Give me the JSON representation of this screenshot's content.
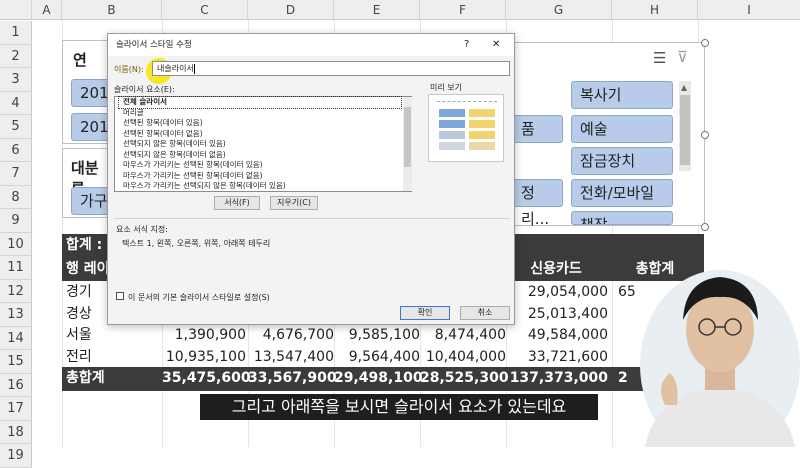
{
  "sheet": {
    "columns": [
      "A",
      "B",
      "C",
      "D",
      "E",
      "F",
      "G",
      "H",
      "I"
    ],
    "rows": [
      "1",
      "2",
      "3",
      "4",
      "5",
      "6",
      "7",
      "8",
      "9",
      "10",
      "11",
      "12",
      "13",
      "14",
      "15",
      "16",
      "17",
      "18",
      "19"
    ]
  },
  "slicer_year": {
    "title": "연",
    "items": [
      "201",
      "201"
    ]
  },
  "slicer_category": {
    "title": "대분류",
    "items": [
      "가구",
      "정리...",
      "전화/모바일",
      "복사기",
      "예술",
      "잠금장치",
      "책장"
    ],
    "partial_item": "품"
  },
  "table": {
    "header_label": "합계 :",
    "row_label_header": "행 레이",
    "col_headers": [
      "신용카드",
      "총합계"
    ],
    "rows": [
      {
        "label": "경기",
        "values": [
          "",
          "",
          "",
          "",
          "29,054,000",
          "65"
        ]
      },
      {
        "label": "경상",
        "values": [
          "",
          "",
          "",
          "",
          "25,013,400",
          ""
        ]
      },
      {
        "label": "서울",
        "values": [
          "1,390,900",
          "4,676,700",
          "9,585,100",
          "8,474,400",
          "49,584,000",
          ""
        ]
      },
      {
        "label": "전리",
        "values": [
          "10,935,100",
          "13,547,400",
          "9,564,400",
          "10,404,000",
          "33,721,600",
          ""
        ]
      }
    ],
    "total": {
      "label": "총합계",
      "values": [
        "35,475,600",
        "33,567,900",
        "29,498,100",
        "28,525,300",
        "137,373,000",
        "2"
      ]
    }
  },
  "dialog": {
    "title": "슬라이서 스타일 수정",
    "help": "?",
    "close": "✕",
    "name_label": "이름(N):",
    "name_value": "내슬라이서",
    "elements_label": "슬라이서 요소(E):",
    "elements": [
      "전체 슬라이서",
      "머리글",
      "선택된 항목(데이터 있음)",
      "선택된 항목(데이터 없음)",
      "선택되지 않은 항목(데이터 있음)",
      "선택되지 않은 항목(데이터 없음)",
      "마우스가 가리키는 선택된 항목(데이터 있음)",
      "마우스가 가리키는 선택된 항목(데이터 없음)",
      "마우스가 가리키는 선택되지 않은 항목(데이터 있음)"
    ],
    "preview_label": "미리 보기",
    "format_button": "서식(F)",
    "clear_button": "지우기(C)",
    "element_format_label": "요소 서식 지정:",
    "element_format_value": "텍스트 1, 왼쪽, 오른쪽, 위쪽, 아래쪽 테두리",
    "default_checkbox_label": "이 문서의 기본 슬라이서 스타일로 설정(S)",
    "ok_button": "확인",
    "cancel_button": "취소"
  },
  "subtitle": "그리고 아래쪽을 보시면 슬라이서 요소가 있는데요",
  "colors": {
    "slicer_button": "#b7cce8",
    "dark_row": "#3b3b3b",
    "highlight": "#f5e400",
    "preview_blue": "#7fa6d8",
    "preview_yellow": "#f3d36b"
  }
}
